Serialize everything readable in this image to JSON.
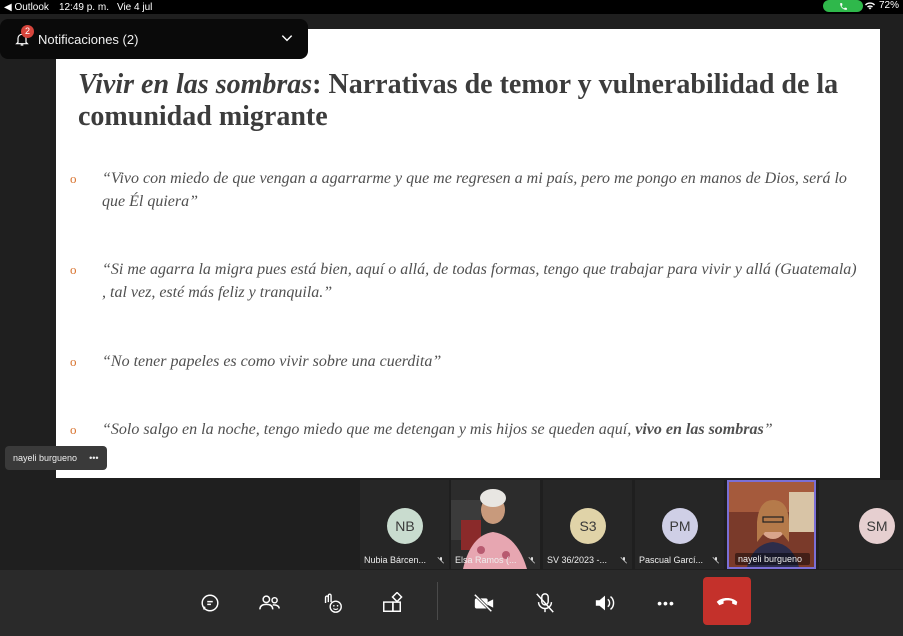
{
  "status_bar": {
    "back_app": "◀ Outlook",
    "time": "12:49 p. m.",
    "date": "Vie 4 jul",
    "battery": "72%"
  },
  "notification": {
    "label": "Notificaciones (2)",
    "count": "2"
  },
  "slide": {
    "title_italic": "Vivir en las sombras",
    "title_rest": ": Narrativas de temor y vulnerabilidad de la comunidad migrante",
    "bullet_mark": "o",
    "quotes": [
      "“Vivo con miedo de que vengan a agarrarme y que me regresen a mi país, pero me pongo en manos de Dios, será lo que Él quiera”",
      "“Si me agarra la migra  pues está bien, aquí o allá, de todas formas,  tengo que trabajar para vivir y allá (Guatemala) , tal vez, esté más feliz y tranquila.”",
      "“No tener papeles es como vivir sobre una cuerdita”"
    ],
    "quote4_plain": "“Solo salgo en la noche, tengo miedo que me detengan y mis hijos se queden aquí, ",
    "quote4_bold": "vivo en las sombras",
    "quote4_end": "”"
  },
  "presenter_tag": {
    "name": "nayeli burgueno",
    "more": "•••"
  },
  "participants": [
    {
      "initials": "NB",
      "caption": "Nubia Bárcen...",
      "color": "#c9dccf"
    },
    {
      "initials": "",
      "caption": "Elsa Ramos (...",
      "color": ""
    },
    {
      "initials": "S3",
      "caption": "SV 36/2023 -...",
      "color": "#e0d3a8"
    },
    {
      "initials": "PM",
      "caption": "Pascual Garcí...",
      "color": "#cfcfe6"
    },
    {
      "initials": "",
      "caption": "nayeli burgueno",
      "color": ""
    },
    {
      "initials": "SM",
      "caption": "",
      "color": "#e6cfd0"
    }
  ],
  "toolbar": {
    "more_label": "•••"
  },
  "colors": {
    "accent_call": "#2fb84b",
    "hangup": "#c4312b",
    "active_border": "#7b6fd6",
    "bullet": "#d8732f"
  }
}
